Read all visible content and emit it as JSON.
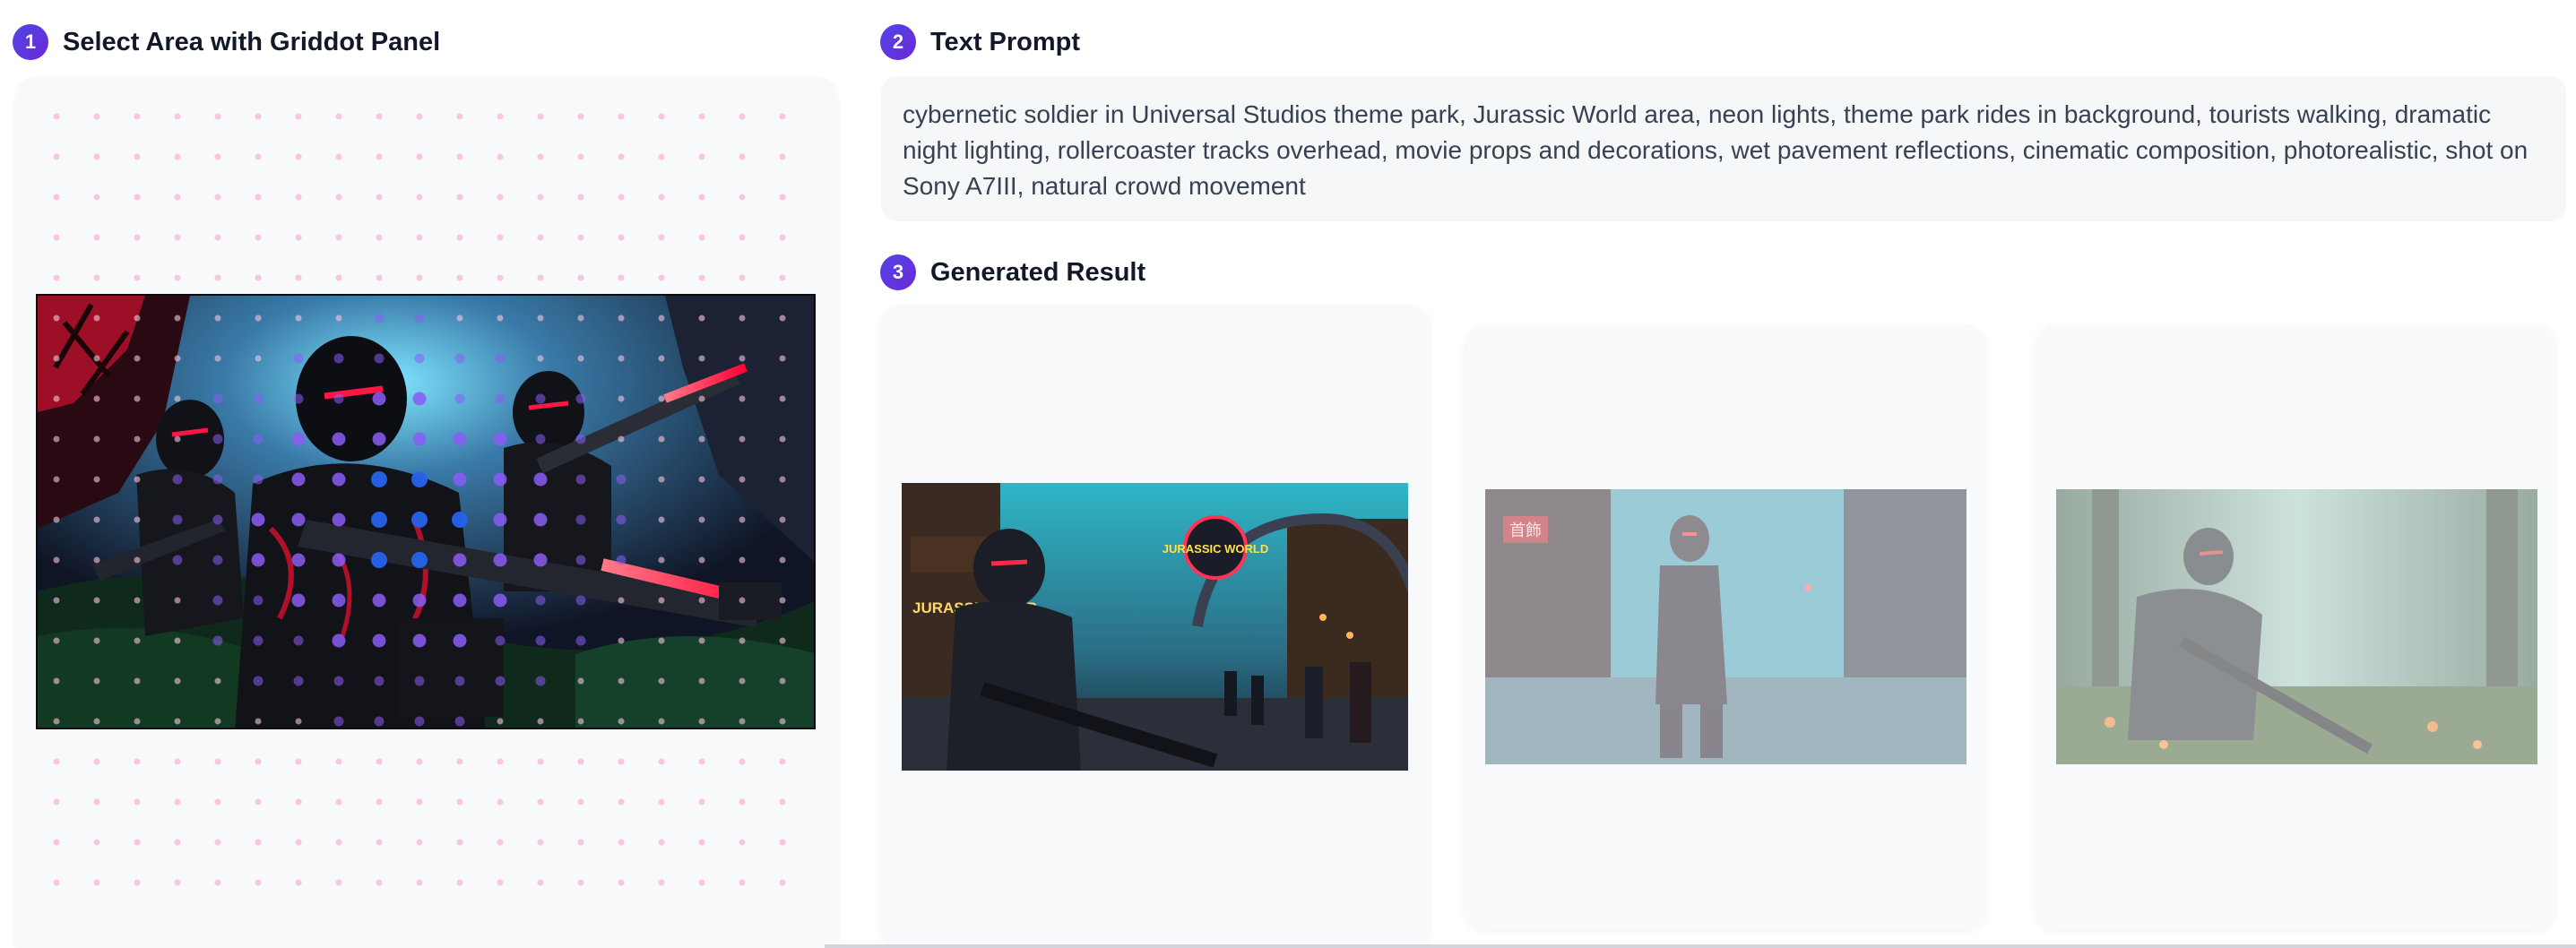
{
  "sections": {
    "select": {
      "step": "1",
      "title": "Select Area with Griddot Panel"
    },
    "prompt": {
      "step": "2",
      "title": "Text Prompt"
    },
    "result": {
      "step": "3",
      "title": "Generated Result"
    }
  },
  "prompt_text": "cybernetic soldier in Universal Studios theme park, Jurassic World area, neon lights, theme park rides in background, tourists walking, dramatic night lighting, rollercoaster tracks overhead, movie props and decorations, wet pavement reflections, cinematic composition, photorealistic, shot on Sony A7III, natural crowd movement",
  "results": [
    {
      "sign": "JURASSIC WORLD",
      "shop_sign": "JURASSIC SHOP",
      "state": "selected"
    },
    {
      "sign": "首飾",
      "state": "faded"
    },
    {
      "state": "faded"
    }
  ],
  "colors": {
    "accent": "#4f46e5",
    "dot_pink": "#f9c6dd",
    "dot_purple": "#8b5cf6",
    "dot_blue": "#2563eb",
    "neon_red": "#ff1744"
  }
}
